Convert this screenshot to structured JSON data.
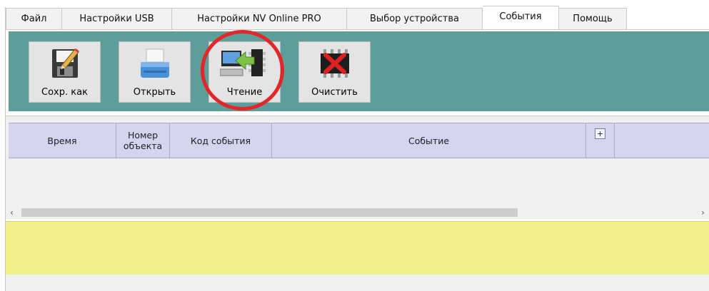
{
  "menu": {
    "tabs": [
      {
        "label": "Файл"
      },
      {
        "label": "Настройки USB"
      },
      {
        "label": "Настройки NV Online PRO"
      },
      {
        "label": "Выбор устройства"
      },
      {
        "label": "События"
      },
      {
        "label": "Помощь"
      }
    ],
    "active_tab": "События"
  },
  "toolbar": {
    "buttons": [
      {
        "label": "Сохр. как",
        "icon": "floppy-pencil-icon"
      },
      {
        "label": "Открыть",
        "icon": "printer-tray-icon"
      },
      {
        "label": "Чтение",
        "icon": "computer-read-arrow-icon"
      },
      {
        "label": "Очистить",
        "icon": "chip-clear-x-icon"
      }
    ],
    "highlighted_button": "Чтение",
    "background_color": "#5e9e9a",
    "highlight_color": "#e32626"
  },
  "events_table": {
    "columns": [
      {
        "label": "Время"
      },
      {
        "label": "Номер объекта"
      },
      {
        "label": "Код события"
      },
      {
        "label": "Событие"
      },
      {
        "label": "+"
      }
    ],
    "rows": []
  },
  "status_panel": {
    "text": "",
    "color": "#f2ee8a"
  },
  "scrollbar": {
    "left_arrow": "‹",
    "right_arrow": "›"
  }
}
